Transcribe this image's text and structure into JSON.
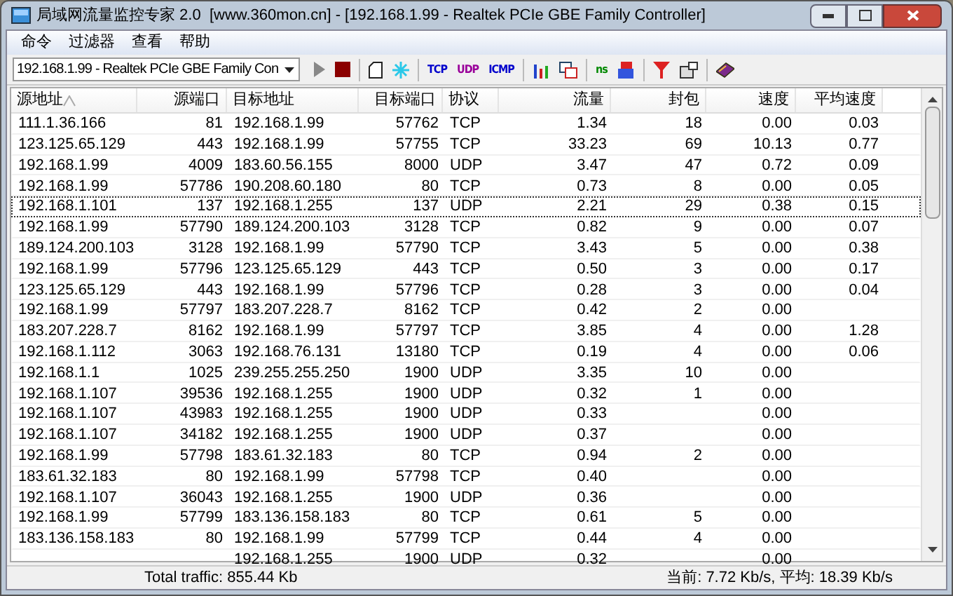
{
  "window": {
    "title": "局域网流量监控专家 2.0  [www.360mon.cn] - [192.168.1.99 - Realtek PCIe GBE Family Controller]"
  },
  "menu": [
    "命令",
    "过滤器",
    "查看",
    "帮助"
  ],
  "toolbar": {
    "adapter": "192.168.1.99 - Realtek PCIe GBE Family Con",
    "tools": [
      {
        "kind": "play"
      },
      {
        "kind": "stop"
      },
      {
        "kind": "sep"
      },
      {
        "kind": "page"
      },
      {
        "kind": "star"
      },
      {
        "kind": "sep"
      },
      {
        "kind": "text",
        "text": "TCP",
        "color": "#0000cc"
      },
      {
        "kind": "text",
        "text": "UDP",
        "color": "#990099"
      },
      {
        "kind": "text",
        "text": "ICMP",
        "color": "#0000cc"
      },
      {
        "kind": "sep"
      },
      {
        "kind": "chart"
      },
      {
        "kind": "windows"
      },
      {
        "kind": "sep"
      },
      {
        "kind": "text",
        "text": "ns",
        "color": "#008800"
      },
      {
        "kind": "numbered"
      },
      {
        "kind": "sep"
      },
      {
        "kind": "filter"
      },
      {
        "kind": "monitor"
      },
      {
        "kind": "sep"
      },
      {
        "kind": "book"
      }
    ]
  },
  "table": {
    "columns": [
      {
        "label": "源地址",
        "sorted": true
      },
      {
        "label": "源端口",
        "sorted": false
      },
      {
        "label": "目标地址",
        "sorted": false
      },
      {
        "label": "目标端口",
        "sorted": false
      },
      {
        "label": "协议",
        "sorted": false
      },
      {
        "label": "流量",
        "sorted": false
      },
      {
        "label": "封包",
        "sorted": false
      },
      {
        "label": "速度",
        "sorted": false
      },
      {
        "label": "平均速度",
        "sorted": false
      }
    ],
    "rows": [
      {
        "cells": [
          "111.1.36.166",
          "81",
          "192.168.1.99",
          "57762",
          "TCP",
          "1.34",
          "18",
          "0.00",
          "0.03"
        ],
        "focused": false
      },
      {
        "cells": [
          "123.125.65.129",
          "443",
          "192.168.1.99",
          "57755",
          "TCP",
          "33.23",
          "69",
          "10.13",
          "0.77"
        ],
        "focused": false
      },
      {
        "cells": [
          "192.168.1.99",
          "4009",
          "183.60.56.155",
          "8000",
          "UDP",
          "3.47",
          "47",
          "0.72",
          "0.09"
        ],
        "focused": false
      },
      {
        "cells": [
          "192.168.1.99",
          "57786",
          "190.208.60.180",
          "80",
          "TCP",
          "0.73",
          "8",
          "0.00",
          "0.05"
        ],
        "focused": false
      },
      {
        "cells": [
          "192.168.1.101",
          "137",
          "192.168.1.255",
          "137",
          "UDP",
          "2.21",
          "29",
          "0.38",
          "0.15"
        ],
        "focused": true
      },
      {
        "cells": [
          "192.168.1.99",
          "57790",
          "189.124.200.103",
          "3128",
          "TCP",
          "0.82",
          "9",
          "0.00",
          "0.07"
        ],
        "focused": false
      },
      {
        "cells": [
          "189.124.200.103",
          "3128",
          "192.168.1.99",
          "57790",
          "TCP",
          "3.43",
          "5",
          "0.00",
          "0.38"
        ],
        "focused": false
      },
      {
        "cells": [
          "192.168.1.99",
          "57796",
          "123.125.65.129",
          "443",
          "TCP",
          "0.50",
          "3",
          "0.00",
          "0.17"
        ],
        "focused": false
      },
      {
        "cells": [
          "123.125.65.129",
          "443",
          "192.168.1.99",
          "57796",
          "TCP",
          "0.28",
          "3",
          "0.00",
          "0.04"
        ],
        "focused": false
      },
      {
        "cells": [
          "192.168.1.99",
          "57797",
          "183.207.228.7",
          "8162",
          "TCP",
          "0.42",
          "2",
          "0.00",
          null
        ],
        "focused": false
      },
      {
        "cells": [
          "183.207.228.7",
          "8162",
          "192.168.1.99",
          "57797",
          "TCP",
          "3.85",
          "4",
          "0.00",
          "1.28"
        ],
        "focused": false
      },
      {
        "cells": [
          "192.168.1.112",
          "3063",
          "192.168.76.131",
          "13180",
          "TCP",
          "0.19",
          "4",
          "0.00",
          "0.06"
        ],
        "focused": false
      },
      {
        "cells": [
          "192.168.1.1",
          "1025",
          "239.255.255.250",
          "1900",
          "UDP",
          "3.35",
          "10",
          "0.00",
          null
        ],
        "focused": false
      },
      {
        "cells": [
          "192.168.1.107",
          "39536",
          "192.168.1.255",
          "1900",
          "UDP",
          "0.32",
          "1",
          "0.00",
          null
        ],
        "focused": false
      },
      {
        "cells": [
          "192.168.1.107",
          "43983",
          "192.168.1.255",
          "1900",
          "UDP",
          "0.33",
          null,
          "0.00",
          null
        ],
        "focused": false
      },
      {
        "cells": [
          "192.168.1.107",
          "34182",
          "192.168.1.255",
          "1900",
          "UDP",
          "0.37",
          null,
          "0.00",
          null
        ],
        "focused": false
      },
      {
        "cells": [
          "192.168.1.99",
          "57798",
          "183.61.32.183",
          "80",
          "TCP",
          "0.94",
          "2",
          "0.00",
          null
        ],
        "focused": false
      },
      {
        "cells": [
          "183.61.32.183",
          "80",
          "192.168.1.99",
          "57798",
          "TCP",
          "0.40",
          null,
          "0.00",
          null
        ],
        "focused": false
      },
      {
        "cells": [
          "192.168.1.107",
          "36043",
          "192.168.1.255",
          "1900",
          "UDP",
          "0.36",
          null,
          "0.00",
          null
        ],
        "focused": false
      },
      {
        "cells": [
          "192.168.1.99",
          "57799",
          "183.136.158.183",
          "80",
          "TCP",
          "0.61",
          "5",
          "0.00",
          null
        ],
        "focused": false
      },
      {
        "cells": [
          "183.136.158.183",
          "80",
          "192.168.1.99",
          "57799",
          "TCP",
          "0.44",
          "4",
          "0.00",
          null
        ],
        "focused": false
      },
      {
        "cells": [
          null,
          null,
          "192.168.1.255",
          "1900",
          "UDP",
          "0.32",
          null,
          "0.00",
          null
        ],
        "focused": false
      }
    ]
  },
  "status_bar": {
    "left": "Total traffic: 855.44 Kb",
    "right": "当前: 7.72 Kb/s, 平均: 18.39 Kb/s"
  }
}
